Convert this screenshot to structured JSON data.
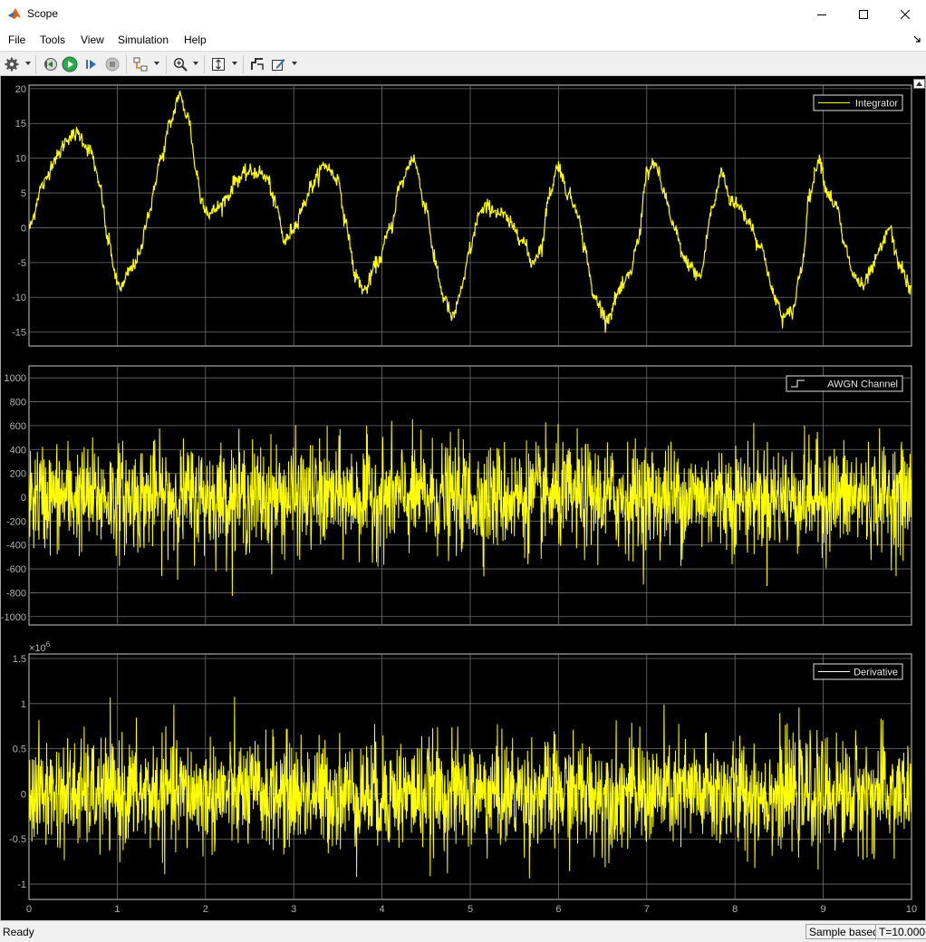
{
  "window": {
    "title": "Scope",
    "accent": "#1e6fd0"
  },
  "menu": {
    "items": [
      "File",
      "Tools",
      "View",
      "Simulation",
      "Help"
    ]
  },
  "toolbar": {
    "icons": [
      "settings-gear-icon",
      "step-back-icon",
      "run-icon",
      "step-forward-icon",
      "stop-icon",
      "signal-select-icon",
      "zoom-icon",
      "autoscale-icon",
      "cursor-measure-icon",
      "highlight-icon"
    ]
  },
  "plot_style": {
    "background": "#000000",
    "trace_color": "#ffff00",
    "axis_text": "#b0b0b0",
    "grid": "#6e6e6e"
  },
  "chart_data": [
    {
      "type": "line",
      "legend": "Integrator",
      "legend_position": "top-right",
      "xlim": [
        0,
        10
      ],
      "ylim": [
        -17,
        20.5
      ],
      "yticks": [
        "-15",
        "-10",
        "-5",
        "0",
        "5",
        "10",
        "15",
        "20"
      ],
      "grid": true,
      "series": [
        {
          "name": "Integrator",
          "x": [
            0,
            0.15,
            0.3,
            0.45,
            0.55,
            0.7,
            0.8,
            0.9,
            1.0,
            1.05,
            1.15,
            1.25,
            1.35,
            1.5,
            1.6,
            1.7,
            1.8,
            1.9,
            1.95,
            2.05,
            2.15,
            2.25,
            2.35,
            2.5,
            2.6,
            2.7,
            2.8,
            2.9,
            3.0,
            3.1,
            3.2,
            3.35,
            3.5,
            3.6,
            3.7,
            3.8,
            3.95,
            4.1,
            4.2,
            4.35,
            4.5,
            4.6,
            4.7,
            4.8,
            4.9,
            5.0,
            5.1,
            5.2,
            5.35,
            5.5,
            5.6,
            5.7,
            5.8,
            5.9,
            6.0,
            6.1,
            6.2,
            6.3,
            6.4,
            6.55,
            6.7,
            6.8,
            6.9,
            7.0,
            7.1,
            7.2,
            7.3,
            7.45,
            7.6,
            7.75,
            7.85,
            7.95,
            8.05,
            8.15,
            8.3,
            8.45,
            8.55,
            8.65,
            8.75,
            8.85,
            8.95,
            9.05,
            9.15,
            9.25,
            9.35,
            9.45,
            9.55,
            9.65,
            9.75,
            9.85,
            10.0
          ],
          "y": [
            0,
            6,
            10,
            13,
            13.5,
            11,
            6,
            -2,
            -8,
            -8.5,
            -6,
            -4,
            2,
            10,
            15,
            19,
            16,
            8,
            4,
            2,
            3,
            4.5,
            7,
            8,
            8,
            7,
            3,
            -2,
            0,
            3,
            6,
            9,
            7,
            0,
            -7,
            -9,
            -5,
            0,
            6,
            10,
            3,
            -5,
            -10,
            -13,
            -9,
            -3,
            2,
            3,
            2,
            0,
            -2,
            -5,
            -3,
            5,
            9,
            5,
            3,
            -3,
            -10,
            -13,
            -9,
            -7,
            -2,
            8,
            9,
            5,
            0,
            -5,
            -7,
            3,
            8,
            4,
            3,
            1,
            -3,
            -10,
            -13,
            -12,
            -6,
            5,
            10,
            5,
            3,
            -3,
            -7,
            -8.5,
            -6,
            -3,
            0,
            -5,
            -9
          ]
        }
      ]
    },
    {
      "type": "line",
      "legend": "AWGN Channel",
      "legend_position": "top-right",
      "xlim": [
        0,
        10
      ],
      "ylim": [
        -1070,
        1100
      ],
      "yticks": [
        "-1000",
        "-800",
        "-600",
        "-400",
        "-200",
        "0",
        "200",
        "400",
        "600",
        "800",
        "1000"
      ],
      "grid": true,
      "series": [
        {
          "name": "AWGN Channel",
          "approx_std": 220,
          "approx_min": -870,
          "approx_max": 860
        }
      ]
    },
    {
      "type": "line",
      "legend": "Derivative",
      "legend_position": "top-right",
      "xlim": [
        0,
        10
      ],
      "ylim": [
        -1.17,
        1.55
      ],
      "yticks": [
        "-1",
        "-0.5",
        "0",
        "0.5",
        "1",
        "1.5"
      ],
      "xticks": [
        "0",
        "1",
        "2",
        "3",
        "4",
        "5",
        "6",
        "7",
        "8",
        "9",
        "10"
      ],
      "y_exponent_label": "×10",
      "y_exponent_power": "6",
      "grid": true,
      "series": [
        {
          "name": "Derivative",
          "approx_std": 0.3,
          "approx_min": -1.1,
          "approx_max": 1.25
        }
      ]
    }
  ],
  "status": {
    "left": "Ready",
    "mode": "Sample based",
    "time": "T=10.000"
  }
}
